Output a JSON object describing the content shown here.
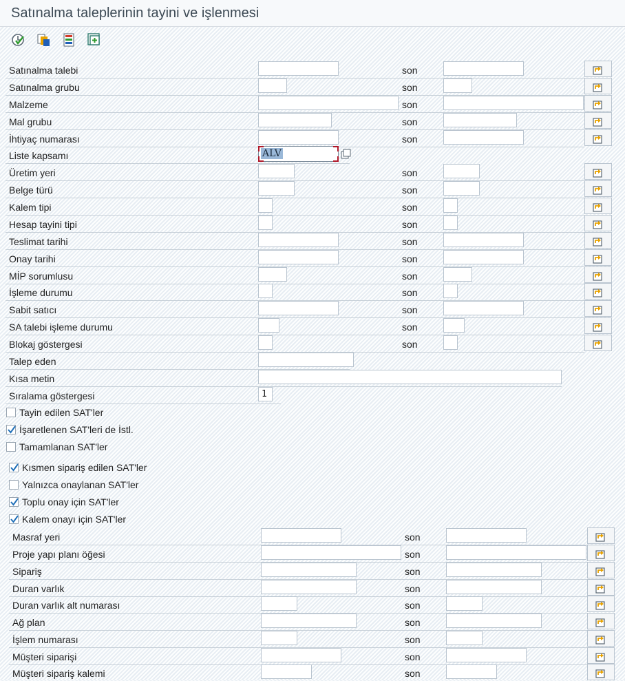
{
  "window": {
    "title": "Satınalma taleplerinin tayini ve işlenmesi"
  },
  "toolbar": {
    "items": [
      {
        "name": "execute-icon"
      },
      {
        "name": "get-variant-icon"
      },
      {
        "name": "selection-options-icon"
      },
      {
        "name": "dynamic-selections-icon"
      }
    ]
  },
  "range_label": "son",
  "list_scope": {
    "label": "Liste kapsamı",
    "value": "ALV"
  },
  "fields": {
    "satinalma_talebi": "Satınalma talebi",
    "satinalma_grubu": "Satınalma grubu",
    "malzeme": "Malzeme",
    "mal_grubu": "Mal grubu",
    "ihtiyac_numarasi": "İhtiyaç numarası",
    "uretim_yeri": "Üretim yeri",
    "belge_turu": "Belge türü",
    "kalem_tipi": "Kalem tipi",
    "hesap_tayini_tipi": "Hesap tayini tipi",
    "teslimat_tarihi": "Teslimat tarihi",
    "onay_tarihi": "Onay tarihi",
    "mip_sorumlusu": "MİP sorumlusu",
    "isleme_durumu": "İşleme durumu",
    "sabit_satici": "Sabit satıcı",
    "sa_talebi_isleme_durumu": "SA talebi işleme durumu",
    "blokaj_gostergesi": "Blokaj göstergesi",
    "talep_eden": "Talep eden",
    "kisa_metin": "Kısa metin",
    "siralama_gostergesi": {
      "label": "Sıralama göstergesi",
      "value": "1"
    },
    "masraf_yeri": "Masraf yeri",
    "proje_yapi_plani_ogesi": "Proje yapı planı öğesi",
    "siparis": "Sipariş",
    "duran_varlik": "Duran varlık",
    "duran_varlik_alt_numarasi": "Duran varlık alt numarası",
    "ag_plan": "Ağ plan",
    "islem_numarasi": "İşlem numarası",
    "musteri_siparisi": "Müşteri siparişi",
    "musteri_siparis_kalemi": "Müşteri sipariş kalemi"
  },
  "checkboxes": {
    "tayin_edilen": {
      "label": "Tayin edilen SAT'ler",
      "checked": false
    },
    "isaretlenen": {
      "label": "İşaretlenen SAT'leri de İstl.",
      "checked": true
    },
    "tamamlanan": {
      "label": "Tamamlanan SAT'ler",
      "checked": false
    },
    "kismen_siparis": {
      "label": "Kısmen sipariş edilen SAT'ler",
      "checked": true
    },
    "yalnizca_onaylanan": {
      "label": "Yalnızca onaylanan SAT'ler",
      "checked": false
    },
    "toplu_onay": {
      "label": "Toplu onay için SAT'ler",
      "checked": true
    },
    "kalem_onayi": {
      "label": "Kalem onayı için SAT'ler",
      "checked": true
    }
  }
}
